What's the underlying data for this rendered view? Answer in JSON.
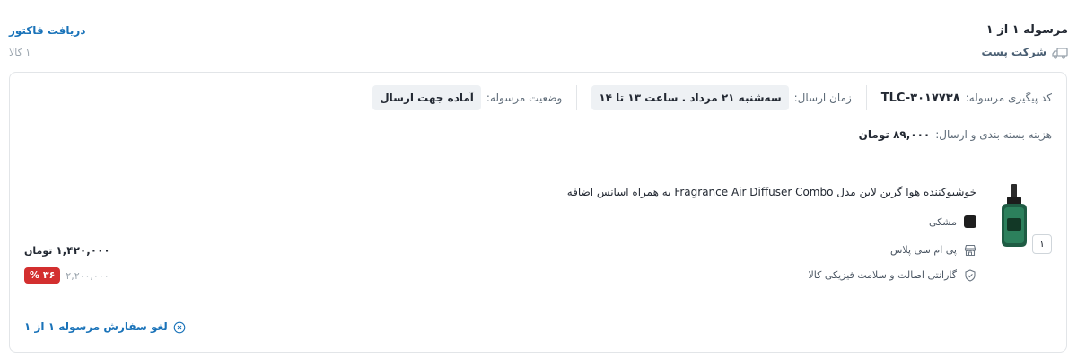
{
  "shipment": {
    "title": "مرسوله ۱ از ۱",
    "carrier": "شرکت پست",
    "carrier_icon": "truck-icon"
  },
  "invoice": {
    "link_label": "دریافت فاکتور",
    "item_count": "۱ کالا"
  },
  "details": {
    "tracking_label": "کد پیگیری مرسوله:",
    "tracking_code": "TLC-۳۰۱۷۷۳۸",
    "delivery_time_label": "زمان ارسال:",
    "delivery_time": "سه‌شنبه ۲۱ مرداد . ساعت ۱۳ تا ۱۴",
    "status_label": "وضعیت مرسوله:",
    "status": "آماده جهت ارسال",
    "shipping_cost_label": "هزینه بسته بندی و ارسال:",
    "shipping_cost": "۸۹,۰۰۰ تومان"
  },
  "product": {
    "title": "خوشبوکننده هوا گرین لاین مدل Fragrance Air Diffuser Combo به همراه اسانس اضافه",
    "quantity": "۱",
    "color_label": "مشکی",
    "color_hex": "#1e1e1e",
    "seller": "پی ام سی پلاس",
    "seller_icon": "store-icon",
    "warranty": "گارانتی اصالت و سلامت فیزیکی کالا",
    "warranty_icon": "shield-check-icon",
    "price": "۱,۴۲۰,۰۰۰",
    "currency": "تومان",
    "old_price": "۲,۲۰۰,۰۰۰",
    "discount": "۳۶ %"
  },
  "actions": {
    "cancel_label": "لغو سفارش مرسوله ۱ از ۱",
    "cancel_icon": "close-circle-icon"
  },
  "colors": {
    "link": "#1a73b9",
    "discount_badge": "#d32f2f",
    "pill_bg": "#eef1f4",
    "border": "#e2e5e8"
  }
}
